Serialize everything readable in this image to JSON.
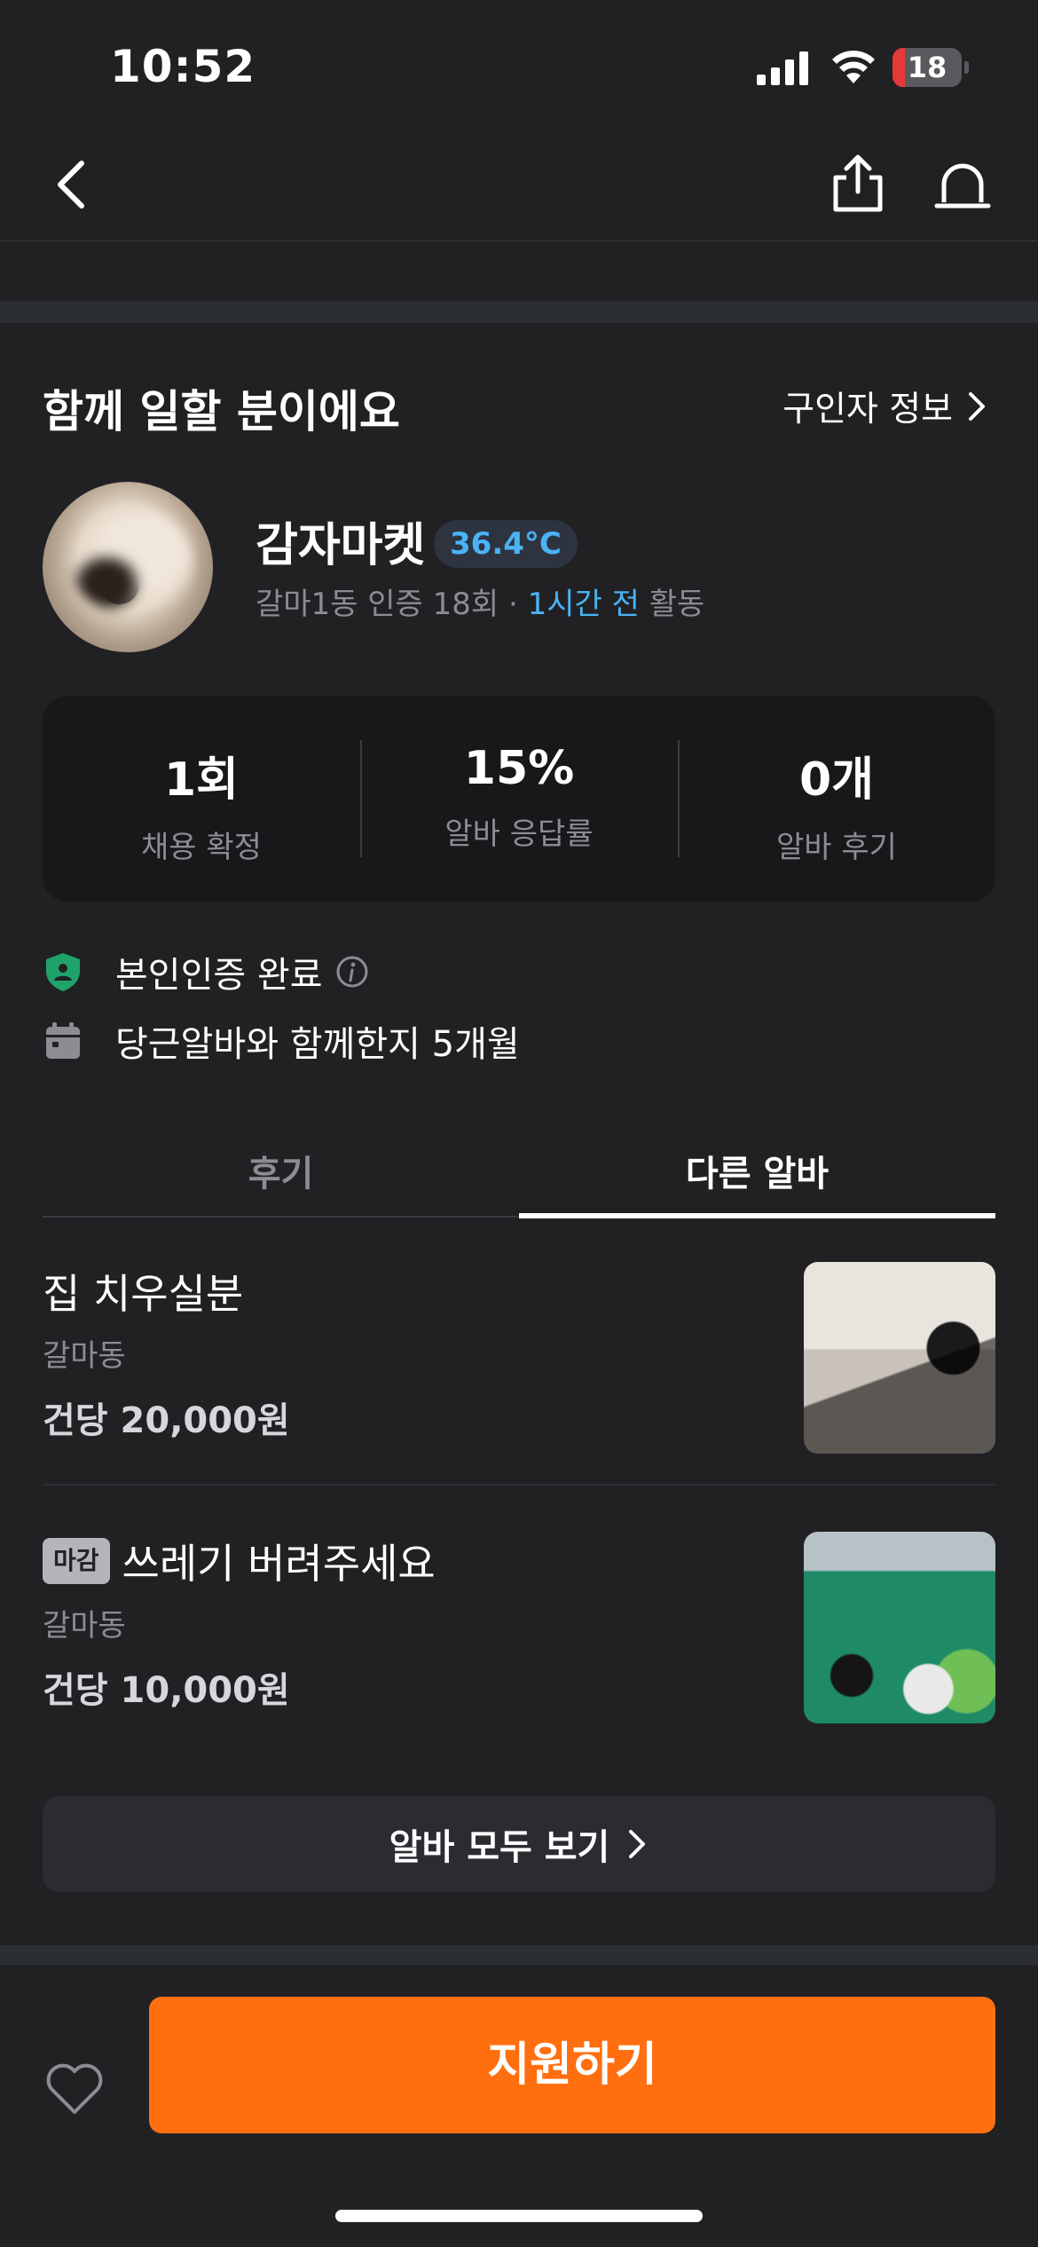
{
  "status_bar": {
    "time": "10:52",
    "battery": "18",
    "battery_level": 0.18
  },
  "nav": {
    "back_icon": "chevron-left-icon",
    "share_icon": "share-icon",
    "alarm_icon": "siren-icon"
  },
  "recruiter": {
    "section_title": "함께 일할 분이에요",
    "info_link": "구인자 정보",
    "nickname": "감자마켓",
    "temperature": "36.4°C",
    "meta_prefix": "갈마1동 인증 18회 · ",
    "meta_time": "1시간 전",
    "meta_suffix": " 활동"
  },
  "stats": [
    {
      "value": "1회",
      "label": "채용 확정"
    },
    {
      "value": "15%",
      "label": "알바 응답률"
    },
    {
      "value": "0개",
      "label": "알바 후기"
    }
  ],
  "badges": {
    "verified": "본인인증 완료",
    "tenure": "당근알바와 함께한지 5개월"
  },
  "tabs": [
    {
      "label": "후기",
      "active": false
    },
    {
      "label": "다른 알바",
      "active": true
    }
  ],
  "jobs": [
    {
      "badge": "",
      "title": "집 치우실분",
      "location": "갈마동",
      "pay": "건당 20,000원"
    },
    {
      "badge": "마감",
      "title": "쓰레기 버려주세요",
      "location": "갈마동",
      "pay": "건당 10,000원"
    }
  ],
  "all_jobs_button": "알바 모두 보기",
  "apply_button": "지원하기",
  "colors": {
    "accent": "#ff6f0f",
    "link": "#4ab3f4",
    "background": "#212124"
  }
}
